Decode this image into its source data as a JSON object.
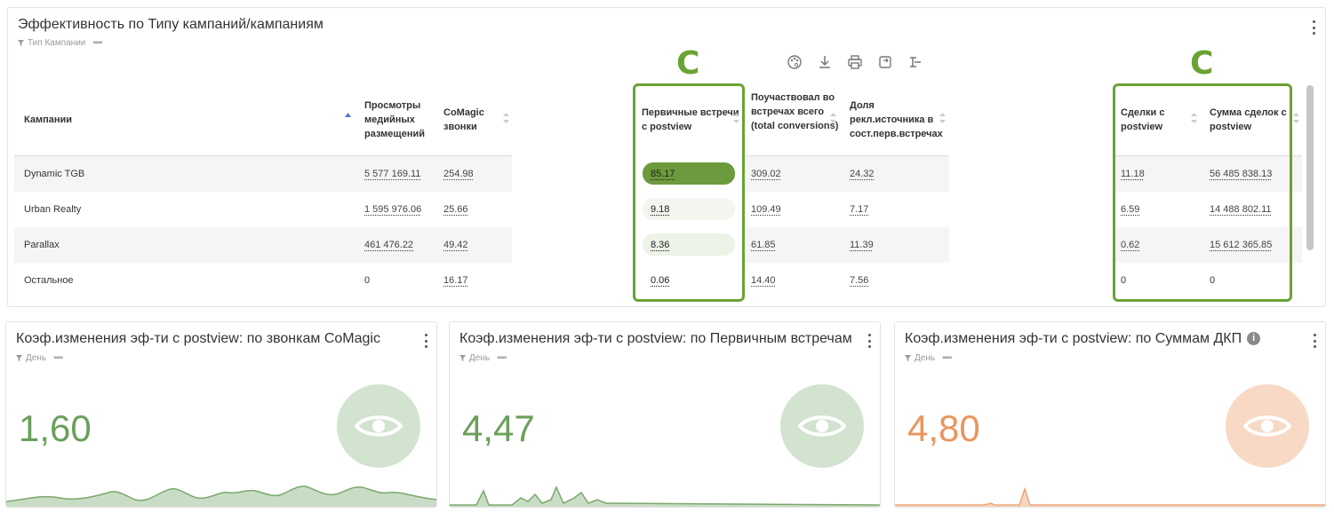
{
  "top_panel": {
    "title": "Эффективность по Типу кампаний/кампаниям",
    "filter": "Тип Кампании",
    "marker": "C",
    "columns": [
      {
        "label": "Кампании"
      },
      {
        "label": "Просмотры медийных размещений"
      },
      {
        "label": "CoMagic звонки"
      },
      {
        "label": "Первичные встречи с postview"
      },
      {
        "label": "Поучаствовал во встречах всего (total conversions)"
      },
      {
        "label": "Доля рекл.источника в сост.перв.встречах"
      },
      {
        "label": "Сделки с postview"
      },
      {
        "label": "Сумма сделок с postview"
      }
    ],
    "rows": [
      {
        "campaign": "Dynamic TGB",
        "views": "5 577 169.11",
        "calls": "254.98",
        "primary": "85.17",
        "total": "309.02",
        "share": "24.32",
        "deals": "11.18",
        "sum": "56 485 838.13"
      },
      {
        "campaign": "Urban Realty",
        "views": "1 595 976.06",
        "calls": "25.66",
        "primary": "9.18",
        "total": "109.49",
        "share": "7.17",
        "deals": "6.59",
        "sum": "14 488 802.11"
      },
      {
        "campaign": "Parallax",
        "views": "461 476.22",
        "calls": "49.42",
        "primary": "8.36",
        "total": "61.85",
        "share": "11.39",
        "deals": "0.62",
        "sum": "15 612 365.85"
      },
      {
        "campaign": "Остальное",
        "views": "0",
        "calls": "16.17",
        "primary": "0.06",
        "total": "14.40",
        "share": "7.56",
        "deals": "0",
        "sum": "0"
      }
    ],
    "toolbar_icons": [
      "palette-icon",
      "download-icon",
      "print-icon",
      "refresh-icon",
      "hierarchy-icon"
    ]
  },
  "cards": [
    {
      "title": "Коэф.изменения эф-ти с postview: по звонкам CoMagic",
      "filter": "День",
      "value": "1,60",
      "color": "#6aa05a",
      "circle": "#d2e3d0",
      "fill": "#c9ddc6"
    },
    {
      "title": "Коэф.изменения эф-ти с postview: по Первичным встречам",
      "filter": "День",
      "value": "4,47",
      "color": "#6aa05a",
      "circle": "#d2e3d0",
      "fill": "#c9ddc6"
    },
    {
      "title": "Коэф.изменения эф-ти с postview: по Суммам ДКП",
      "filter": "День",
      "value": "4,80",
      "color": "#e9955d",
      "circle": "#f7d9c5",
      "fill": "#f6d6c0"
    }
  ]
}
